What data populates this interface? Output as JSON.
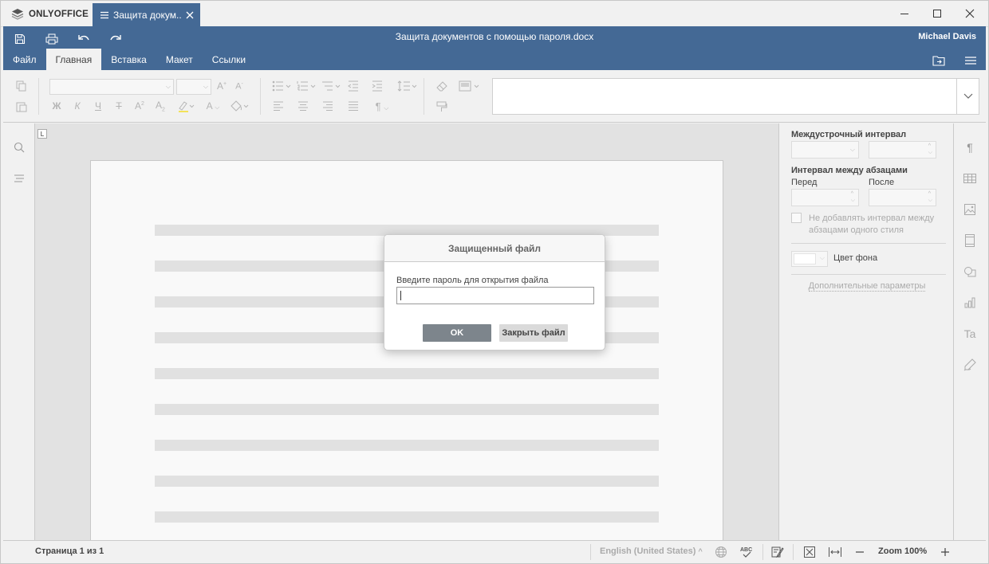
{
  "app": {
    "brand": "ONLYOFFICE",
    "tab_title": "Защита докум...",
    "doc_title": "Защита документов с помощью пароля.docx",
    "user": "Michael Davis"
  },
  "menu": {
    "tabs": [
      "Файл",
      "Главная",
      "Вставка",
      "Макет",
      "Ссылки"
    ],
    "active": "Главная"
  },
  "dialog": {
    "title": "Защищенный файл",
    "prompt": "Введите пароль для открытия файла",
    "password_value": "",
    "ok_label": "OK",
    "close_label": "Закрыть файл"
  },
  "right_panel": {
    "line_spacing_title": "Междустрочный интервал",
    "paragraph_spacing_title": "Интервал между абзацами",
    "before_label": "Перед",
    "after_label": "После",
    "no_space_checkbox": "Не добавлять интервал между абзацами одного стиля",
    "no_space_checked": false,
    "bg_color_label": "Цвет фона",
    "advanced_link": "Дополнительные параметры"
  },
  "status": {
    "page_info": "Страница 1 из 1",
    "language": "English (United States)",
    "zoom": "Zoom 100%"
  },
  "colors": {
    "header_blue": "#446995",
    "ok_button": "#7d858c",
    "panel_bg": "#f1f1f1"
  },
  "icons": [
    "save-icon",
    "print-icon",
    "undo-icon",
    "redo-icon",
    "open-location-icon",
    "hamburger-menu-icon",
    "search-icon",
    "navigation-icon",
    "paragraph-settings-icon",
    "table-settings-icon",
    "image-settings-icon",
    "header-footer-icon",
    "shape-settings-icon",
    "chart-settings-icon",
    "text-art-icon",
    "signature-icon",
    "globe-icon",
    "spellcheck-icon",
    "track-changes-icon",
    "fit-page-icon",
    "fit-width-icon",
    "zoom-out-icon",
    "zoom-in-icon"
  ]
}
